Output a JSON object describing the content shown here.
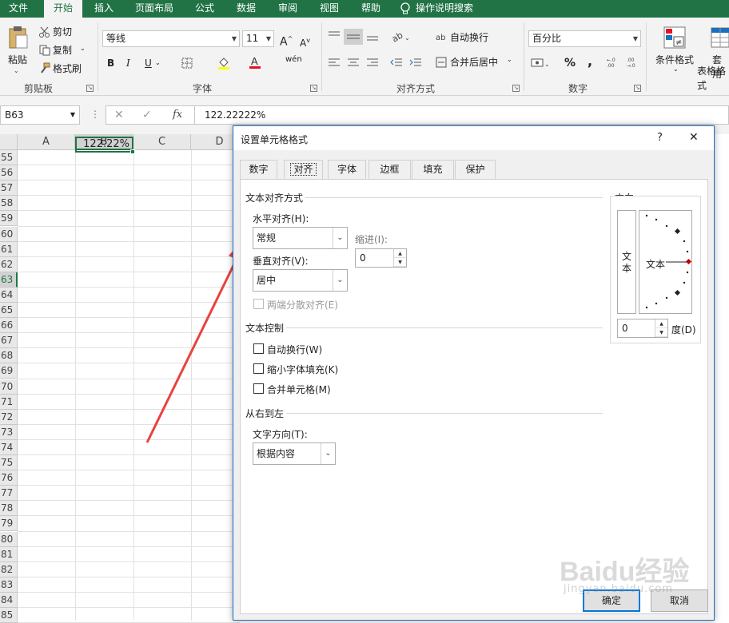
{
  "menu": {
    "tabs": [
      "文件",
      "开始",
      "插入",
      "页面布局",
      "公式",
      "数据",
      "审阅",
      "视图",
      "帮助"
    ],
    "active": "开始",
    "tell_me": "操作说明搜索"
  },
  "clipboard": {
    "paste": "粘贴",
    "cut": "剪切",
    "copy": "复制",
    "format_painter": "格式刷",
    "group": "剪贴板"
  },
  "font": {
    "name": "等线",
    "size": "11",
    "bold": "B",
    "italic": "I",
    "underline": "U",
    "wen": "wén",
    "group": "字体"
  },
  "alignment": {
    "wrap": "自动换行",
    "merge": "合并后居中",
    "group": "对齐方式"
  },
  "number": {
    "format": "百分比",
    "percent": "%",
    "comma": ",",
    "group": "数字"
  },
  "styles": {
    "conditional": "条件格式",
    "table": "套用",
    "table2": "表格格式"
  },
  "formula_bar": {
    "name_box": "B63",
    "value": "122.22222%",
    "fx": "fx"
  },
  "sheet": {
    "columns": [
      "A",
      "B",
      "C",
      "D"
    ],
    "selected_column": "B",
    "rows": [
      "55",
      "56",
      "57",
      "58",
      "59",
      "60",
      "61",
      "62",
      "63",
      "64",
      "65",
      "66",
      "67",
      "68",
      "69",
      "70",
      "71",
      "72",
      "73",
      "74",
      "75",
      "76",
      "77",
      "78",
      "79",
      "80",
      "81",
      "82",
      "83",
      "84",
      "85"
    ],
    "selected_row": "63",
    "cell_value": "122.22%"
  },
  "dialog": {
    "title": "设置单元格格式",
    "help": "?",
    "close": "✕",
    "tabs": [
      "数字",
      "对齐",
      "字体",
      "边框",
      "填充",
      "保护"
    ],
    "active_tab": "对齐",
    "text_align_section": "文本对齐方式",
    "horizontal_label": "水平对齐(H):",
    "horizontal_value": "常规",
    "indent_label": "缩进(I):",
    "indent_value": "0",
    "vertical_label": "垂直对齐(V):",
    "vertical_value": "居中",
    "distributed_label": "两端分散对齐(E)",
    "text_control_section": "文本控制",
    "wrap_label": "自动换行(W)",
    "shrink_label": "缩小字体填充(K)",
    "merge_label": "合并单元格(M)",
    "rtl_section": "从右到左",
    "direction_label": "文字方向(T):",
    "direction_value": "根据内容",
    "orientation_section": "方向",
    "orient_vertical_text": "文本",
    "orient_text": "文本",
    "degree_value": "0",
    "degree_label": "度(D)",
    "ok": "确定",
    "cancel": "取消"
  },
  "watermark": {
    "text": "Baidu经验",
    "url": "jingyan.baidu.com"
  },
  "colors": {
    "accent": "#217346",
    "dialog_border": "#1c6fbd",
    "arrow": "#e8433f"
  }
}
